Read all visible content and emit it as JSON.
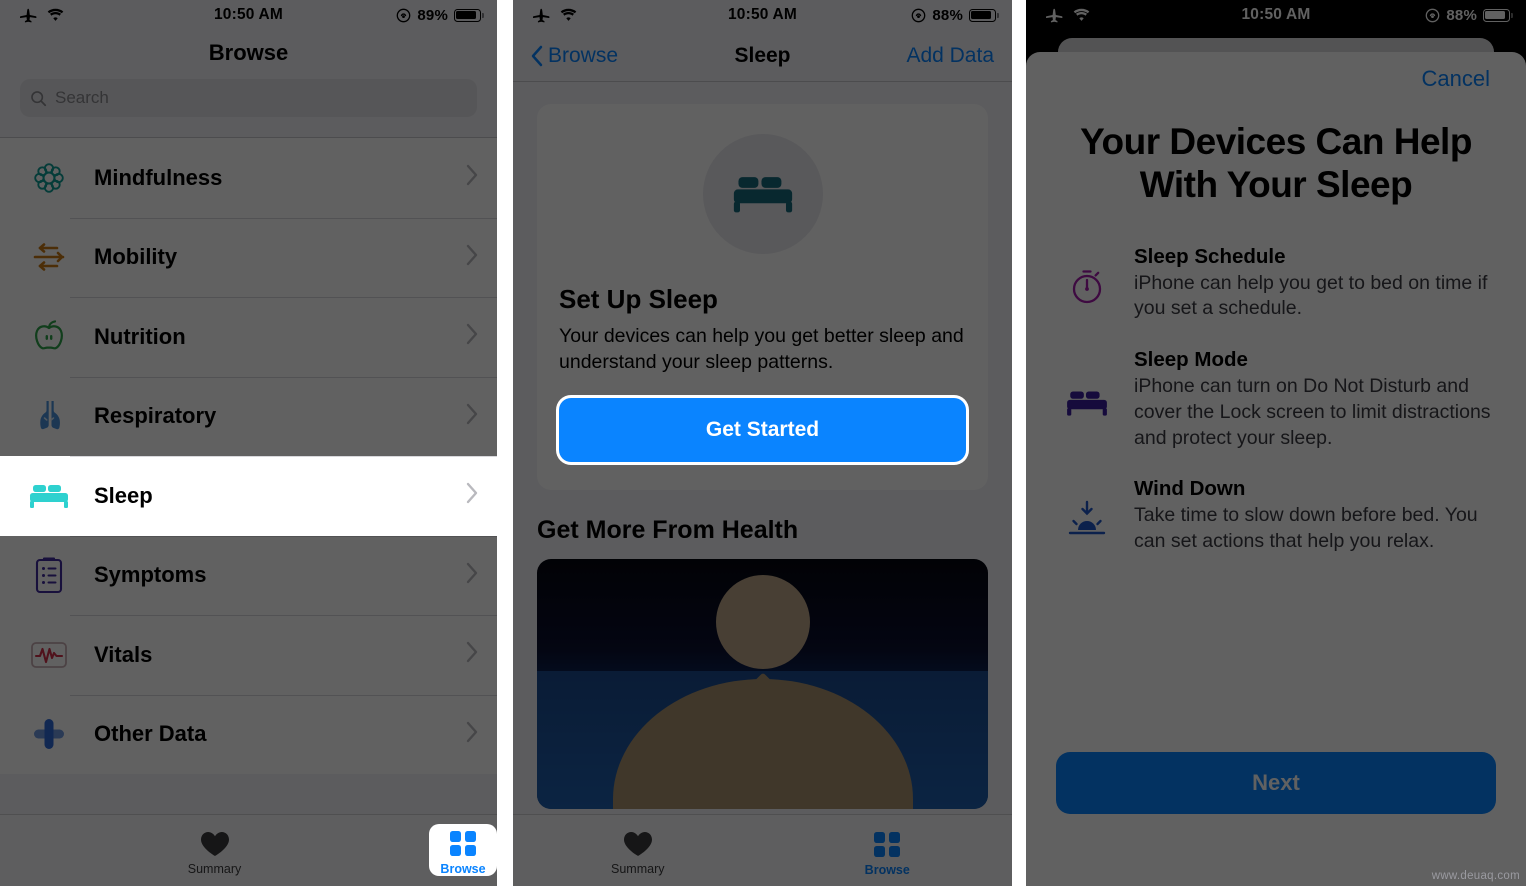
{
  "watermark": "www.deuaq.com",
  "colors": {
    "accent_blue": "#0a84ff",
    "sleep_teal": "#2ed1cf",
    "mindfulness_teal": "#0e9e95",
    "mobility_orange": "#c97a17",
    "nutrition_green": "#2fa24a",
    "respiratory_blue": "#4a90d9",
    "symptoms_purple": "#3f2a9e",
    "vitals_red": "#d1304a",
    "other_blue": "#2f6bd8",
    "schedule_purple": "#a31caa",
    "sleepmode_purple": "#3c1e9e",
    "winddown_blue": "#2158c9"
  },
  "panel1": {
    "status": {
      "airplane_icon": "airplane-icon",
      "wifi_icon": "wifi-icon",
      "time": "10:50 AM",
      "lock_icon": "rotation-lock-icon",
      "battery": "89%"
    },
    "title": "Browse",
    "search": {
      "placeholder": "Search",
      "icon": "search-icon"
    },
    "rows": [
      {
        "label": "Mindfulness",
        "icon": "mindfulness-icon"
      },
      {
        "label": "Mobility",
        "icon": "mobility-icon"
      },
      {
        "label": "Nutrition",
        "icon": "nutrition-icon"
      },
      {
        "label": "Respiratory",
        "icon": "respiratory-icon"
      },
      {
        "label": "Sleep",
        "icon": "sleep-bed-icon",
        "highlighted": true
      },
      {
        "label": "Symptoms",
        "icon": "symptoms-clipboard-icon"
      },
      {
        "label": "Vitals",
        "icon": "vitals-heartbeat-icon"
      },
      {
        "label": "Other Data",
        "icon": "other-data-cross-icon"
      }
    ],
    "tabs": [
      {
        "label": "Summary",
        "icon": "heart-icon",
        "active": false
      },
      {
        "label": "Browse",
        "icon": "grid-squares-icon",
        "active": true
      }
    ]
  },
  "panel2": {
    "status": {
      "time": "10:50 AM",
      "battery": "88%"
    },
    "nav": {
      "back_label": "Browse",
      "back_icon": "chevron-left-icon",
      "title": "Sleep",
      "action_label": "Add Data"
    },
    "card": {
      "icon": "sleep-bed-icon",
      "heading": "Set Up Sleep",
      "description": "Your devices can help you get better sleep and understand your sleep patterns.",
      "button_label": "Get Started"
    },
    "section_heading": "Get More From Health",
    "hero_image_alt": "night-sky-meditation-image",
    "tabs": [
      {
        "label": "Summary",
        "icon": "heart-icon",
        "active": false
      },
      {
        "label": "Browse",
        "icon": "grid-squares-icon",
        "active": true
      }
    ]
  },
  "panel3": {
    "status": {
      "time": "10:50 AM",
      "battery": "88%"
    },
    "cancel_label": "Cancel",
    "heading": "Your Devices Can Help With Your Sleep",
    "features": [
      {
        "icon": "stopwatch-icon",
        "title": "Sleep Schedule",
        "description": "iPhone can help you get to bed on time if you set a schedule."
      },
      {
        "icon": "bed-icon",
        "title": "Sleep Mode",
        "description": "iPhone can turn on Do Not Disturb and cover the Lock screen to limit distractions and protect your sleep."
      },
      {
        "icon": "sunset-down-arrow-icon",
        "title": "Wind Down",
        "description": "Take time to slow down before bed. You can set actions that help you relax."
      }
    ],
    "next_label": "Next"
  }
}
